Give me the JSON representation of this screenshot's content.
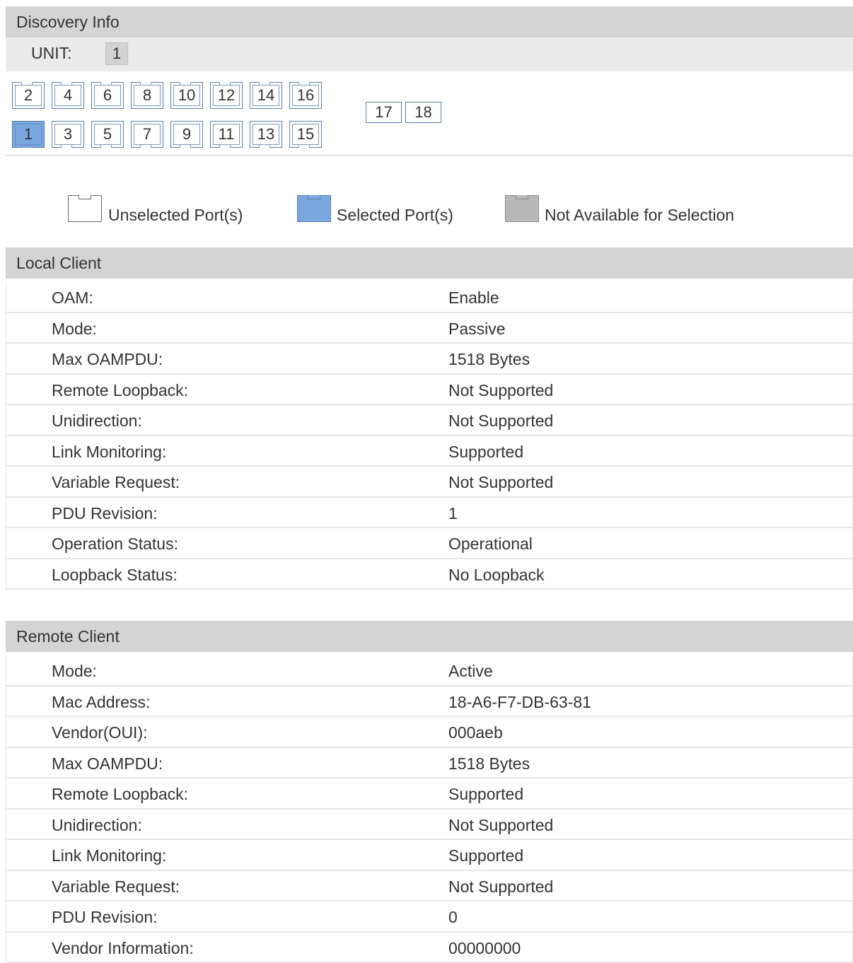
{
  "discovery": {
    "title": "Discovery Info",
    "unit_label": "UNIT:",
    "unit_value": "1",
    "ports_top": [
      "2",
      "4",
      "6",
      "8",
      "10",
      "12",
      "14",
      "16"
    ],
    "ports_bottom": [
      "1",
      "3",
      "5",
      "7",
      "9",
      "11",
      "13",
      "15"
    ],
    "sfp_ports": [
      "17",
      "18"
    ],
    "selected_port": "1",
    "legend": {
      "unselected": "Unselected Port(s)",
      "selected": "Selected Port(s)",
      "not_available": "Not Available for Selection"
    }
  },
  "local_client": {
    "title": "Local Client",
    "rows": [
      {
        "label": "OAM:",
        "value": "Enable"
      },
      {
        "label": "Mode:",
        "value": "Passive"
      },
      {
        "label": "Max OAMPDU:",
        "value": "1518 Bytes"
      },
      {
        "label": "Remote Loopback:",
        "value": "Not Supported"
      },
      {
        "label": "Unidirection:",
        "value": "Not Supported"
      },
      {
        "label": "Link Monitoring:",
        "value": "Supported"
      },
      {
        "label": "Variable Request:",
        "value": "Not Supported"
      },
      {
        "label": "PDU Revision:",
        "value": "1"
      },
      {
        "label": "Operation Status:",
        "value": "Operational"
      },
      {
        "label": "Loopback Status:",
        "value": "No Loopback"
      }
    ]
  },
  "remote_client": {
    "title": "Remote Client",
    "rows": [
      {
        "label": "Mode:",
        "value": "Active"
      },
      {
        "label": "Mac Address:",
        "value": "18-A6-F7-DB-63-81"
      },
      {
        "label": "Vendor(OUI):",
        "value": "000aeb"
      },
      {
        "label": "Max OAMPDU:",
        "value": "1518 Bytes"
      },
      {
        "label": "Remote Loopback:",
        "value": "Supported"
      },
      {
        "label": "Unidirection:",
        "value": "Not Supported"
      },
      {
        "label": "Link Monitoring:",
        "value": "Supported"
      },
      {
        "label": "Variable Request:",
        "value": "Not Supported"
      },
      {
        "label": "PDU Revision:",
        "value": "0"
      },
      {
        "label": "Vendor Information:",
        "value": "00000000"
      }
    ]
  },
  "colors": {
    "header_bg": "#d4d4d4",
    "selected_port": "#7aa7dd",
    "unavailable_port": "#b8b8b8"
  }
}
